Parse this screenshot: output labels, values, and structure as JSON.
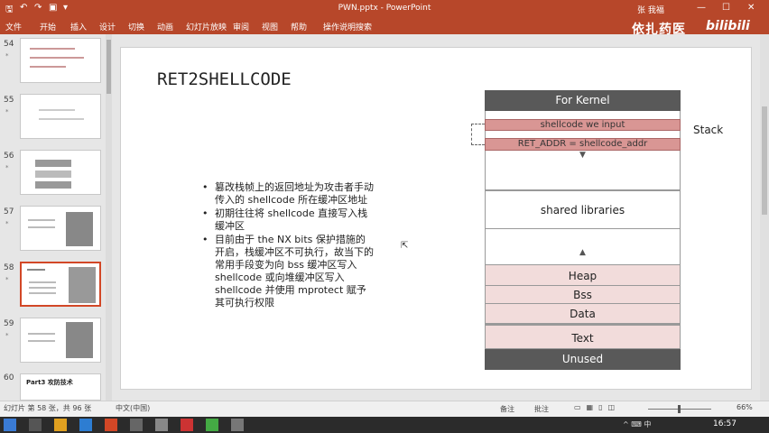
{
  "titlebar": {
    "title": "PWN.pptx - PowerPoint",
    "user": "张 我福",
    "quick_access": [
      "save-icon",
      "undo-icon",
      "redo-icon",
      "present-icon",
      "customize-icon"
    ],
    "window_buttons": [
      "minimize",
      "maximize",
      "close"
    ]
  },
  "ribbon": {
    "tabs": [
      "文件",
      "开始",
      "插入",
      "设计",
      "切换",
      "动画",
      "幻灯片放映",
      "审阅",
      "视图",
      "帮助",
      "操作说明搜索"
    ]
  },
  "watermark": {
    "text": "依扎药医",
    "logo": "bilibili"
  },
  "thumbnails": [
    {
      "num": "54",
      "star": "*"
    },
    {
      "num": "55",
      "star": "*"
    },
    {
      "num": "56",
      "star": "*"
    },
    {
      "num": "57",
      "star": "*"
    },
    {
      "num": "58",
      "star": "*"
    },
    {
      "num": "59",
      "star": "*"
    },
    {
      "num": "60",
      "star": "",
      "preview_text": "Part3 攻防技术"
    }
  ],
  "slide": {
    "title": "RET2SHELLCODE",
    "bullets": [
      "篡改栈帧上的返回地址为攻击者手动传入的 shellcode 所在缓冲区地址",
      "初期往往将 shellcode 直接写入栈缓冲区",
      "目前由于 the NX bits 保护措施的开启，栈缓冲区不可执行，故当下的常用手段变为向 bss 缓冲区写入 shellcode 或向堆缓冲区写入 shellcode 并使用 mprotect 赋予其可执行权限"
    ],
    "memory": {
      "kernel": "For Kernel",
      "shellcode": "shellcode we input",
      "ret_addr": "RET_ADDR = shellcode_addr",
      "stack_label": "Stack",
      "shared": "shared libraries",
      "heap": "Heap",
      "bss": "Bss",
      "data": "Data",
      "text": "Text",
      "unused": "Unused"
    }
  },
  "statusbar": {
    "slide_info": "幻灯片 第 58 张，共 96 张",
    "language": "中文(中国)",
    "notes": "备注",
    "comments": "批注",
    "zoom": "66%"
  },
  "taskbar": {
    "clock": "16:57",
    "tray": "^ ⌨ 中"
  },
  "colors": {
    "accent": "#b7472a",
    "block_dark": "#595959",
    "block_pink": "#f2dcdb",
    "block_red": "#d99694"
  }
}
